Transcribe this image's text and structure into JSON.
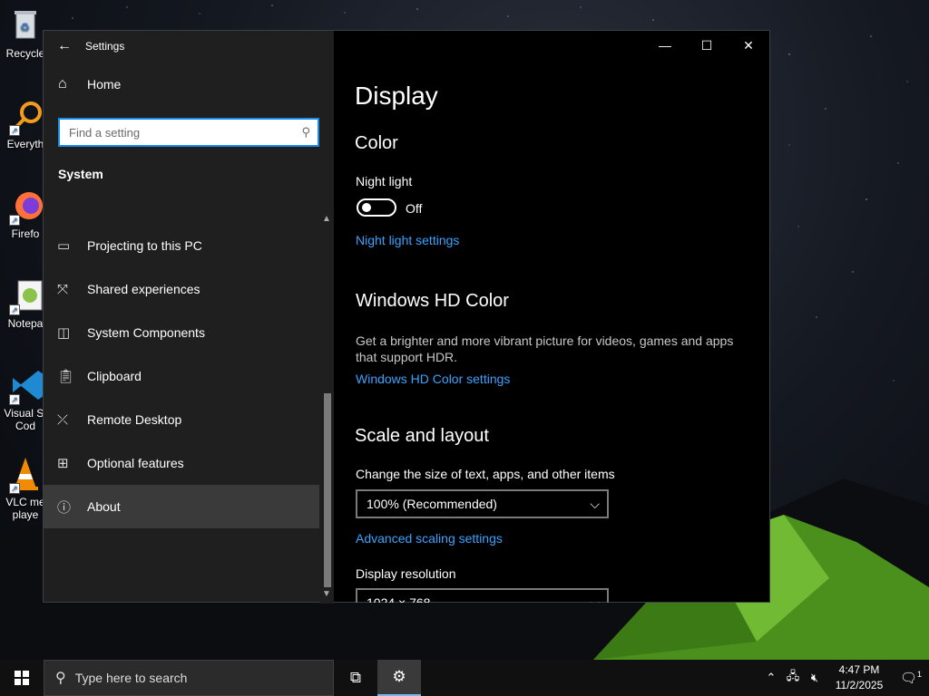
{
  "desktop": {
    "icons": [
      {
        "label": "Recycle",
        "icon": "recycle-bin-icon"
      },
      {
        "label": "Everyth",
        "icon": "everything-search-icon"
      },
      {
        "label": "Firefo",
        "icon": "firefox-icon"
      },
      {
        "label": "Notepa",
        "icon": "notepad-plus-plus-icon"
      },
      {
        "label": "Visual St",
        "label2": "Cod",
        "icon": "vscode-icon"
      },
      {
        "label": "VLC me",
        "label2": "playe",
        "icon": "vlc-icon"
      }
    ]
  },
  "window": {
    "title": "Settings",
    "sidebar": {
      "home_label": "Home",
      "search_placeholder": "Find a setting",
      "section": "System",
      "items": [
        {
          "label": "Projecting to this PC",
          "icon": "projector-icon"
        },
        {
          "label": "Shared experiences",
          "icon": "shared-experiences-icon"
        },
        {
          "label": "System Components",
          "icon": "system-components-icon"
        },
        {
          "label": "Clipboard",
          "icon": "clipboard-icon"
        },
        {
          "label": "Remote Desktop",
          "icon": "remote-desktop-icon"
        },
        {
          "label": "Optional features",
          "icon": "optional-features-icon"
        },
        {
          "label": "About",
          "icon": "info-icon",
          "selected": true
        }
      ]
    },
    "content": {
      "title": "Display",
      "color_heading": "Color",
      "night_light_label": "Night light",
      "night_light_state": "Off",
      "night_light_link": "Night light settings",
      "hdr_heading": "Windows HD Color",
      "hdr_desc": "Get a brighter and more vibrant picture for videos, games and apps that support HDR.",
      "hdr_link": "Windows HD Color settings",
      "scale_heading": "Scale and layout",
      "scale_label": "Change the size of text, apps, and other items",
      "scale_value": "100% (Recommended)",
      "advanced_scaling_link": "Advanced scaling settings",
      "resolution_label": "Display resolution",
      "resolution_value": "1024 × 768"
    }
  },
  "taskbar": {
    "search_placeholder": "Type here to search",
    "time": "4:47 PM",
    "date": "11/2/2025",
    "notification_count": "1"
  },
  "colors": {
    "accent": "#1a8ae6",
    "link": "#3ba3ff",
    "sidebar_bg": "#1f1f1f"
  }
}
